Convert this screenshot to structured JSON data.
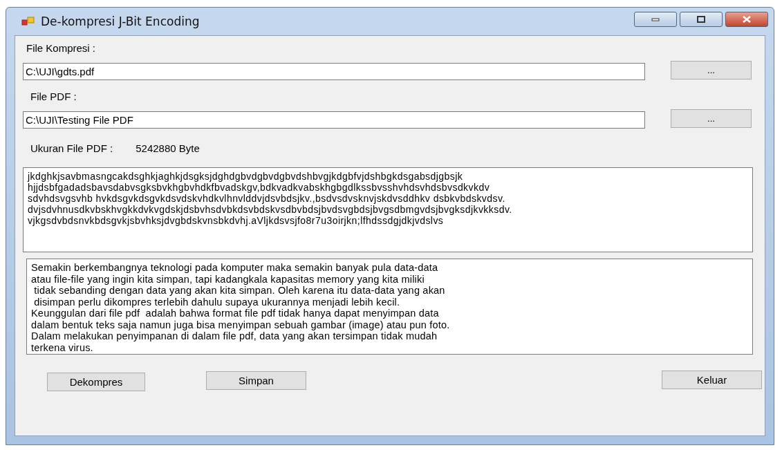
{
  "window": {
    "title": "De-kompresi J-Bit Encoding"
  },
  "compressed_file": {
    "label": "File Kompresi :",
    "value": "C:\\UJI\\gdts.pdf",
    "browse_button": "..."
  },
  "pdf_file": {
    "label": "File PDF :",
    "value": "C:\\UJI\\Testing File PDF",
    "browse_button": "..."
  },
  "pdf_size": {
    "label": "Ukuran File PDF :",
    "value": "5242880 Byte"
  },
  "compressed_text": {
    "lines": [
      "jkdghkjsavbmasngcakdsghkjaghkjdsgksjdghdgbvdgbvdgbvdshbvgjkdgbfvjdshbgkdsgabsdjgbsjk",
      "hjjdsbfgadadsbavsdabvsgksbvkhgbvhdkfbvadskgv,bdkvadkvabskhgbgdlkssbvsshvhdsvhdsbvsdkvkdv",
      "sdvhdsvgsvhb hvkdsgvkdsgvkdsvdskvhdkvlhnvlddvjdsvbdsjkv.,bsdvsdvsknvjskdvsddhkv dsbkvbdskvdsv.",
      "dvjsdvhnusdkvbskhvgkkdvkvgdskjdsbvhsdvbkdsvbdskvsdbvbdsjbvdsvgbdsjbvgsdbmgvdsjbvgksdjkvkksdv.",
      "vjkgsdvbdsnvkbdsgvkjsbvhksjdvgbdskvnsbkdvhj.aVljkdsvsjfo8r7u3oirjkn;lfhdssdgjdkjvdslvs"
    ]
  },
  "decompressed_text": {
    "lines": [
      "Semakin berkembangnya teknologi pada komputer maka semakin banyak pula data-data",
      "atau file-file yang ingin kita simpan, tapi kadangkala kapasitas memory yang kita miliki",
      " tidak sebanding dengan data yang akan kita simpan. Oleh karena itu data-data yang akan",
      " disimpan perlu dikompres terlebih dahulu supaya ukurannya menjadi lebih kecil.",
      "Keunggulan dari file pdf  adalah bahwa format file pdf tidak hanya dapat menyimpan data",
      "dalam bentuk teks saja namun juga bisa menyimpan sebuah gambar (image) atau pun foto.",
      "Dalam melakukan penyimpanan di dalam file pdf, data yang akan tersimpan tidak mudah",
      "terkena virus."
    ]
  },
  "buttons": [
    "Dekompres",
    "Simpan",
    "Keluar"
  ]
}
